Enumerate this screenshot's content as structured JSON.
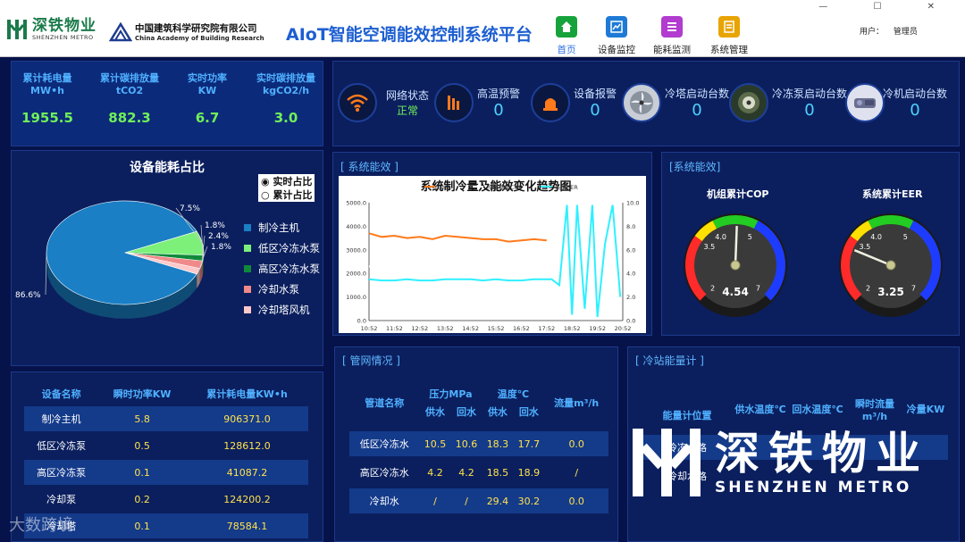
{
  "header": {
    "logo1_cn": "深铁物业",
    "logo1_en": "SHENZHEN METRO",
    "logo2_cn": "中国建筑科学研究院有限公司",
    "logo2_en": "China Academy of Building Research",
    "app_title": "AIoT智能空调能效控制系统平台",
    "nav": [
      {
        "label": "首页",
        "icon": "home-icon",
        "color": "#17a33b"
      },
      {
        "label": "设备监控",
        "icon": "monitor-icon",
        "color": "#1e7ad6"
      },
      {
        "label": "能耗监测",
        "icon": "list-icon",
        "color": "#b23bd0"
      },
      {
        "label": "系统管理",
        "icon": "edit-icon",
        "color": "#e8a400"
      }
    ],
    "user_label": "用户：",
    "user_name": "管理员",
    "window_controls": "— ☐ ✕"
  },
  "kpis": [
    {
      "title": "累计耗电量",
      "unit": "MW•h",
      "value": "1955.5"
    },
    {
      "title": "累计碳排放量",
      "unit": "tCO2",
      "value": "882.3"
    },
    {
      "title": "实时功率",
      "unit": "KW",
      "value": "6.7"
    },
    {
      "title": "实时碳排放量",
      "unit": "kgCO2/h",
      "value": "3.0"
    }
  ],
  "statuses": [
    {
      "label": "网络状态",
      "value": "正常",
      "icon": "wifi-icon"
    },
    {
      "label": "高温预警",
      "value": "0",
      "icon": "thermometer-icon"
    },
    {
      "label": "设备报警",
      "value": "0",
      "icon": "alarm-icon"
    },
    {
      "label": "冷塔启动台数",
      "value": "0",
      "icon": "fan-icon"
    },
    {
      "label": "冷冻泵启动台数",
      "value": "0",
      "icon": "pump-icon"
    },
    {
      "label": "冷机启动台数",
      "value": "0",
      "icon": "chiller-icon"
    }
  ],
  "pie": {
    "title": "设备能耗占比",
    "radio_realtime": "实时占比",
    "radio_cumulative": "累计占比",
    "colors": [
      "#1a7fc4",
      "#7df07a",
      "#0f8a3a",
      "#f08a8a",
      "#ffc8c8"
    ],
    "chart_data": {
      "type": "pie",
      "title": "设备能耗占比",
      "categories": [
        "制冷主机",
        "低区冷冻水泵",
        "高区冷冻水泵",
        "冷却水泵",
        "冷却塔风机"
      ],
      "values": [
        86.6,
        7.5,
        1.8,
        2.4,
        1.8
      ],
      "labels": [
        "86.6%",
        "7.5%",
        "1.8%",
        "2.4%",
        "1.8%"
      ],
      "legend": "right"
    }
  },
  "equipment_table": {
    "headers": [
      "设备名称",
      "瞬时功率KW",
      "累计耗电量KW•h"
    ],
    "rows": [
      [
        "制冷主机",
        "5.8",
        "906371.0"
      ],
      [
        "低区冷冻泵",
        "0.5",
        "128612.0"
      ],
      [
        "高区冷冻泵",
        "0.1",
        "41087.2"
      ],
      [
        "冷却泵",
        "0.2",
        "124200.2"
      ],
      [
        "冷却塔",
        "0.1",
        "78584.1"
      ]
    ]
  },
  "trend": {
    "panel_title": "[ 系统能效 ]",
    "chart_data": {
      "type": "line",
      "title": "系统制冷量及能效变化趋势图",
      "x_ticks": [
        "10:52",
        "11:52",
        "12:52",
        "13:52",
        "14:52",
        "15:52",
        "16:52",
        "17:52",
        "18:52",
        "19:52",
        "20:52"
      ],
      "y_ticks_left": [
        "0.0",
        "1000.0",
        "2000.0",
        "3000.0",
        "4000.0",
        "5000.0"
      ],
      "y_ticks_right": [
        "0.0",
        "2.0",
        "4.0",
        "6.0",
        "8.0",
        "10.0"
      ],
      "ylim_left": [
        0,
        5000
      ],
      "ylim_right": [
        0,
        10
      ],
      "legend": "top",
      "series": [
        {
          "name": "冷量",
          "axis": "left",
          "color": "#ff7a1a",
          "x": [
            0,
            0.5,
            1,
            1.5,
            2,
            2.5,
            3,
            3.5,
            4,
            4.5,
            5,
            5.5,
            6,
            6.5,
            7
          ],
          "values": [
            3700,
            3550,
            3600,
            3500,
            3550,
            3450,
            3600,
            3550,
            3500,
            3450,
            3450,
            3350,
            3400,
            3450,
            3400
          ]
        },
        {
          "name": "冷机整体COP",
          "axis": "right",
          "color": "#ffffff",
          "x": [
            0,
            0.5,
            1,
            1.5,
            2,
            2.5,
            3,
            3.5,
            4,
            4.5,
            5,
            5.5,
            6,
            6.5,
            7,
            7.3,
            7.6,
            7.8,
            8.0,
            8.3,
            8.6,
            8.9,
            9.3,
            9.6,
            9.9
          ],
          "values": [
            4.6,
            4.5,
            4.5,
            4.6,
            4.5,
            4.4,
            4.5,
            4.5,
            4.4,
            4.4,
            4.4,
            4.4,
            4.4,
            4.4,
            4.4,
            4.4,
            4.8,
            2.5,
            7.5,
            2.0,
            6.5,
            3.0,
            4.0,
            6.0,
            3.0
          ]
        },
        {
          "name": "系统EER",
          "axis": "right",
          "color": "#2ff0ff",
          "x": [
            0,
            0.5,
            1,
            1.5,
            2,
            2.5,
            3,
            3.5,
            4,
            4.5,
            5,
            5.5,
            6,
            6.5,
            7,
            7.2,
            7.5,
            7.8,
            8.0,
            8.2,
            8.5,
            8.8,
            9.0,
            9.3,
            9.6,
            9.9
          ],
          "values": [
            3.5,
            3.4,
            3.4,
            3.5,
            3.4,
            3.4,
            3.5,
            3.5,
            3.5,
            3.4,
            3.5,
            3.4,
            3.4,
            3.5,
            3.5,
            3.5,
            3.0,
            9.8,
            0.5,
            9.8,
            1.0,
            9.8,
            0.3,
            6.5,
            9.8,
            2.0
          ]
        }
      ]
    }
  },
  "gauges": {
    "panel_title": "[系统能效]",
    "items": [
      {
        "title": "机组累计COP",
        "value": "4.54",
        "ticks": [
          "2",
          "3.5",
          "4.0",
          "5",
          "7"
        ],
        "chart_data": {
          "type": "gauge",
          "value": 4.54,
          "min": 2,
          "max": 7,
          "bands": [
            [
              2,
              3.5,
              "#ff2a2a"
            ],
            [
              3.5,
              4.0,
              "#ffe000"
            ],
            [
              4.0,
              5,
              "#22cc22"
            ],
            [
              5,
              7,
              "#1e3cff"
            ]
          ]
        }
      },
      {
        "title": "系统累计EER",
        "value": "3.25",
        "ticks": [
          "2",
          "3.5",
          "4.0",
          "5",
          "7"
        ],
        "chart_data": {
          "type": "gauge",
          "value": 3.25,
          "min": 2,
          "max": 7,
          "bands": [
            [
              2,
              3.5,
              "#ff2a2a"
            ],
            [
              3.5,
              4.0,
              "#ffe000"
            ],
            [
              4.0,
              5,
              "#22cc22"
            ],
            [
              5,
              7,
              "#1e3cff"
            ]
          ]
        }
      }
    ]
  },
  "pipe": {
    "panel_title": "[ 管网情况 ]",
    "h_name": "管道名称",
    "h_pressure": "压力MPa",
    "h_temp": "温度℃",
    "h_flow": "流量m³/h",
    "h_supply": "供水",
    "h_return": "回水",
    "rows": [
      [
        "低区冷冻水",
        "10.5",
        "10.6",
        "18.3",
        "17.7",
        "0.0"
      ],
      [
        "高区冷冻水",
        "4.2",
        "4.2",
        "18.5",
        "18.9",
        "/"
      ],
      [
        "冷却水",
        "/",
        "/",
        "29.4",
        "30.2",
        "0.0"
      ]
    ]
  },
  "meter": {
    "panel_title": "[ 冷站能量计 ]",
    "headers": [
      "能量计位置",
      "供水温度℃",
      "回水温度℃",
      "瞬时流量m³/h",
      "冷量KW"
    ],
    "rows": [
      [
        "冷冻水路",
        "",
        "",
        "",
        ""
      ],
      [
        "冷却水路",
        "",
        "",
        "",
        ""
      ]
    ]
  },
  "watermark": {
    "cn": "深铁物业",
    "en": "SHENZHEN METRO",
    "corner": "大数跨境"
  }
}
